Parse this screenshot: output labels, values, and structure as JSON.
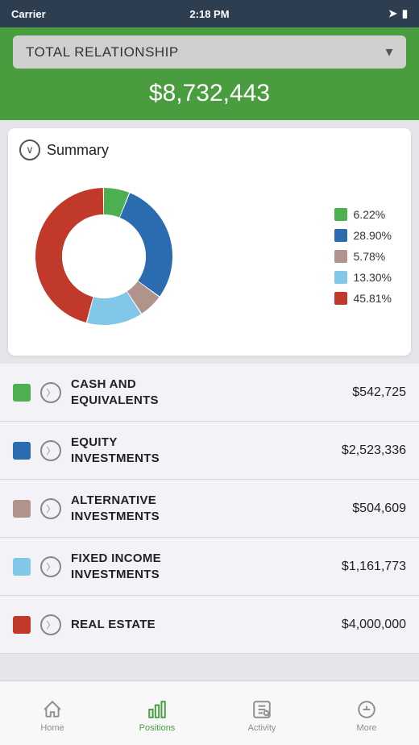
{
  "statusBar": {
    "carrier": "Carrier",
    "time": "2:18 PM",
    "wifi": true,
    "battery": "75%"
  },
  "header": {
    "dropdownLabel": "TOTAL RELATIONSHIP",
    "totalAmount": "$8,732,443"
  },
  "summary": {
    "title": "Summary",
    "chevron": "chevron-down",
    "legend": [
      {
        "color": "#4caf50",
        "percent": "6.22%"
      },
      {
        "color": "#2b6cb0",
        "percent": "28.90%"
      },
      {
        "color": "#b0938a",
        "percent": "5.78%"
      },
      {
        "color": "#81c8e8",
        "percent": "13.30%"
      },
      {
        "color": "#c0392b",
        "percent": "45.81%"
      }
    ]
  },
  "categories": [
    {
      "color": "#4caf50",
      "name": "CASH AND\nEQUIVALENTS",
      "value": "$542,725"
    },
    {
      "color": "#2b6cb0",
      "name": "EQUITY\nINVESTMENTS",
      "value": "$2,523,336"
    },
    {
      "color": "#b0938a",
      "name": "ALTERNATIVE\nINVESTMENTS",
      "value": "$504,609"
    },
    {
      "color": "#81c8e8",
      "name": "FIXED INCOME\nINVESTMENTS",
      "value": "$1,161,773"
    },
    {
      "color": "#c0392b",
      "name": "REAL ESTATE",
      "value": "$4,000,000"
    }
  ],
  "tabs": [
    {
      "id": "home",
      "label": "Home",
      "active": false
    },
    {
      "id": "positions",
      "label": "Positions",
      "active": true
    },
    {
      "id": "activity",
      "label": "Activity",
      "active": false
    },
    {
      "id": "more",
      "label": "More",
      "active": false
    }
  ],
  "donut": {
    "segments": [
      {
        "color": "#4caf50",
        "percent": 6.22
      },
      {
        "color": "#2b6cb0",
        "percent": 28.9
      },
      {
        "color": "#b0938a",
        "percent": 5.78
      },
      {
        "color": "#81c8e8",
        "percent": 13.3
      },
      {
        "color": "#c0392b",
        "percent": 45.81
      }
    ]
  }
}
